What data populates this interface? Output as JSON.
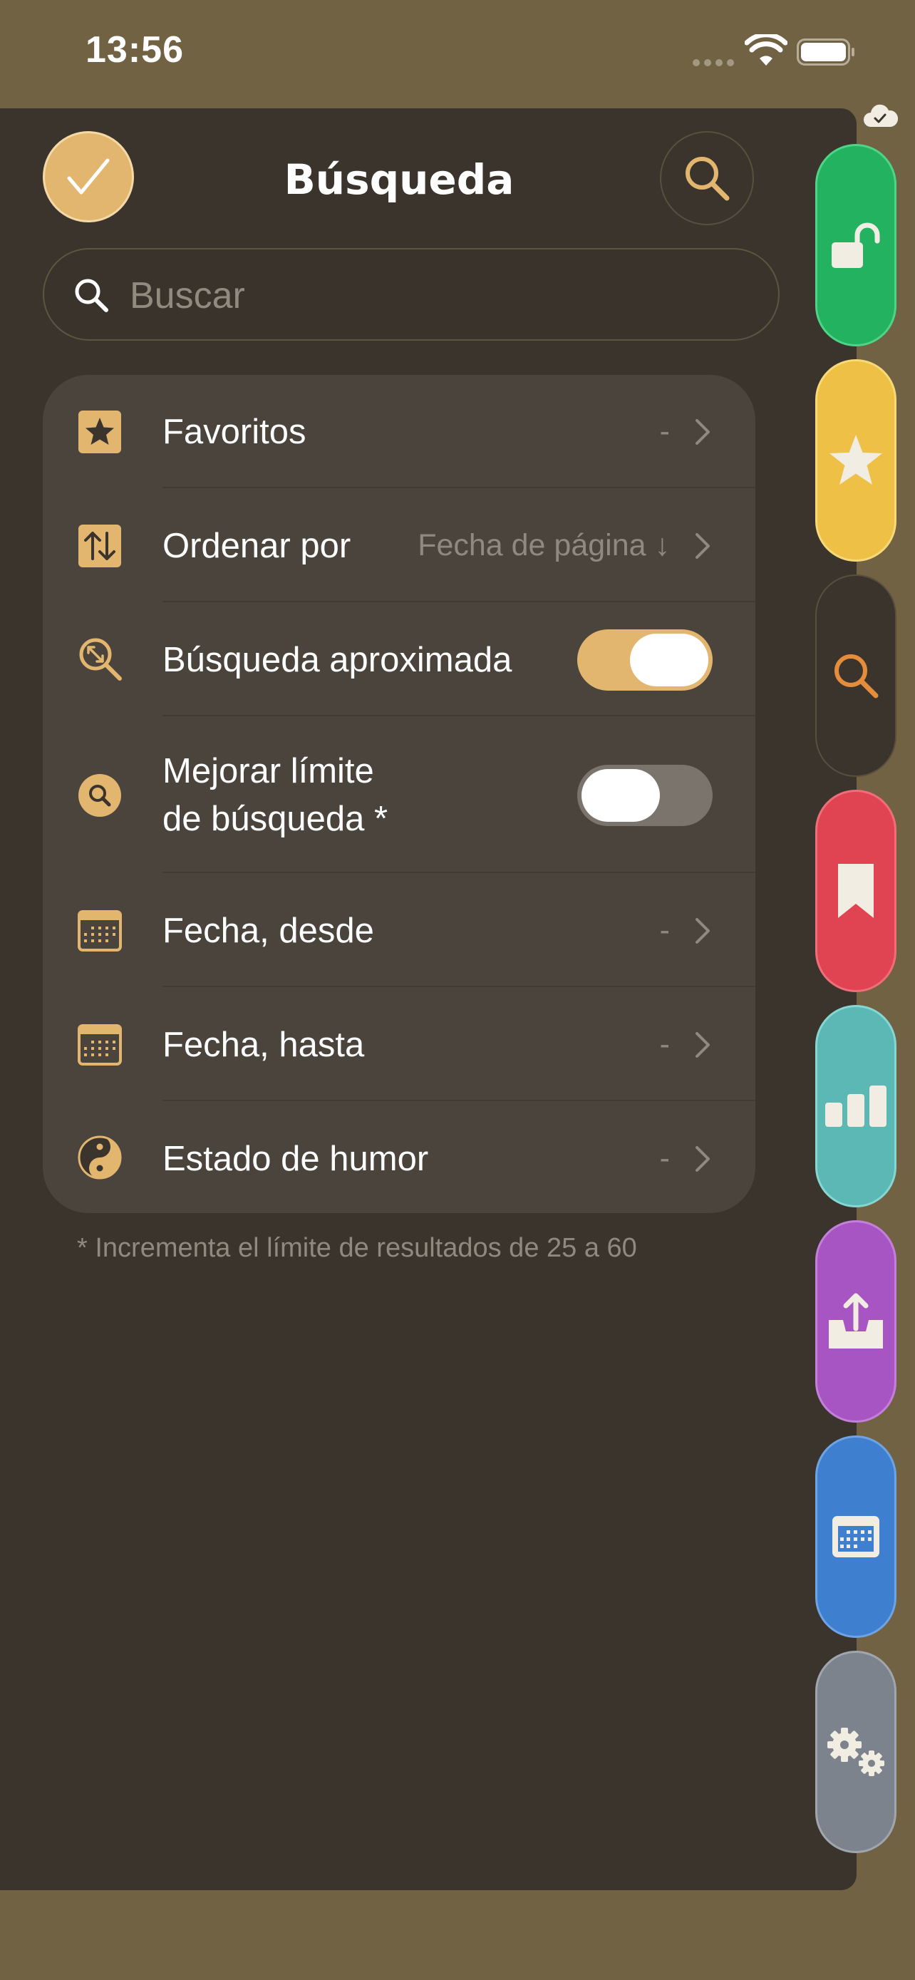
{
  "status_bar": {
    "time": "13:56"
  },
  "header": {
    "title": "Búsqueda"
  },
  "search": {
    "placeholder": "Buscar",
    "value": ""
  },
  "options": {
    "favorites": {
      "label": "Favoritos",
      "value": "-"
    },
    "sort": {
      "label": "Ordenar por",
      "value": "Fecha de página ↓"
    },
    "fuzzy": {
      "label": "Búsqueda aproximada",
      "enabled": true
    },
    "limit": {
      "label_line1": "Mejorar límite",
      "label_line2": "de búsqueda *",
      "enabled": false
    },
    "date_from": {
      "label": "Fecha, desde",
      "value": "-"
    },
    "date_to": {
      "label": "Fecha, hasta",
      "value": "-"
    },
    "mood": {
      "label": "Estado de humor",
      "value": "-"
    }
  },
  "footnote": "* Incrementa el límite de resultados de 25 a 60",
  "side_tabs": [
    {
      "icon": "unlock-icon",
      "color": "#22b260"
    },
    {
      "icon": "star-icon",
      "color": "#eec046"
    },
    {
      "icon": "search-icon",
      "color": "#3a342d"
    },
    {
      "icon": "bookmark-icon",
      "color": "#e04453"
    },
    {
      "icon": "bar-chart-icon",
      "color": "#5bb8b5"
    },
    {
      "icon": "export-icon",
      "color": "#a755c3"
    },
    {
      "icon": "calendar-icon",
      "color": "#3f7fcf"
    },
    {
      "icon": "gears-icon",
      "color": "#7c838d"
    }
  ],
  "colors": {
    "accent": "#e3b670",
    "panel": "#3a342d",
    "card": "#4a443d",
    "frame": "#726244"
  }
}
